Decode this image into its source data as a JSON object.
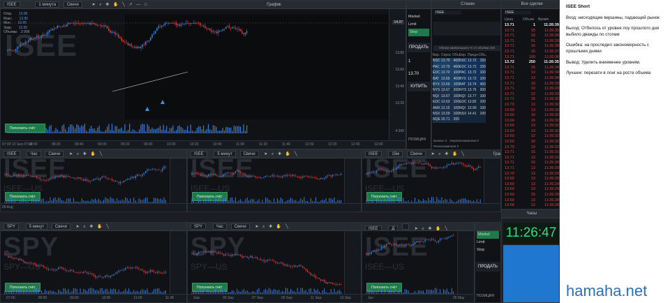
{
  "main_chart": {
    "symbol": "ISEE",
    "interval": "1 минута",
    "type": "Свечи",
    "title": "График",
    "ohlc_labels": [
      "Откр.",
      "Макс.",
      "Мин.",
      "Закр.",
      "Объемы"
    ],
    "ohlc_values": [
      "13.95",
      "13.95",
      "13.95",
      "13.95",
      "3 906"
    ],
    "price_ticks": [
      "14.37",
      "13.80",
      "13.60",
      "13.40",
      "13.20"
    ],
    "time_ticks": [
      "08:00",
      "08:20",
      "08:40",
      "09:00",
      "09:20",
      "09:40",
      "10:00",
      "10:20",
      "10:40",
      "11:00",
      "11:20",
      "11:40",
      "12:00",
      "12:20",
      "12:40",
      "13:00"
    ],
    "date_label": "07:00 13 Sep 07:22",
    "fill_button": "Пополнить счёт",
    "watermark": "ISEE",
    "volume_label": "4 200"
  },
  "order_panel": {
    "title": "Заявка",
    "type_items": [
      "Market",
      "Limit",
      "Stop"
    ],
    "sell_label": "ПРОДАТЬ",
    "qty": "1",
    "price": "13.70",
    "buy_label": "КУПИТЬ",
    "position_label": "ПОЗИЦИЯ"
  },
  "dom": {
    "title": "Стакан",
    "symbol": "ISEE",
    "header": [
      "Бир.",
      "Спрос",
      "Объ.",
      "Бир.",
      "Предл.",
      "Объ."
    ],
    "rows": [
      [
        "NSC",
        "13.70",
        "400",
        "NSC",
        "13.72",
        "150"
      ],
      [
        "PAC",
        "13.70",
        "400",
        "EDC",
        "13.72",
        "150"
      ],
      [
        "EDC",
        "13.70",
        "100",
        "PAC",
        "13.72",
        "100"
      ],
      [
        "BAT",
        "13.69",
        "400",
        "BYX",
        "13.73",
        "100"
      ],
      [
        "BYX",
        "13.69",
        "100",
        "BAT",
        "13.74",
        "400"
      ],
      [
        "NYS",
        "13.67",
        "200",
        "NYS",
        "13.76",
        "300"
      ],
      [
        "NQI",
        "13.67",
        "100",
        "NQI",
        "13.77",
        "100"
      ],
      [
        "EDC",
        "13.63",
        "100",
        "EDC",
        "13.82",
        "100"
      ],
      [
        "AMX",
        "13.15",
        "100",
        "NQI",
        "13.90",
        "100"
      ],
      [
        "NSX",
        "13.09",
        "100",
        "NSX",
        "14.41",
        "100"
      ],
      [
        "NQE",
        "15.71",
        "200",
        "",
        "",
        ""
      ]
    ],
    "bottom": [
      "Баланс 0",
      "Нереализованная 0",
      "Реализованная 0"
    ]
  },
  "trades": {
    "title": "Все сделки",
    "symbol": "ISEE",
    "header": [
      "Цена",
      "Объем",
      "Время"
    ],
    "rows": [
      [
        "13.71",
        "1",
        "11:26:39",
        "w"
      ],
      [
        "13.71",
        "15",
        "11:26:39",
        "r"
      ],
      [
        "13.71",
        "10",
        "11:26:39",
        "r"
      ],
      [
        "13.71",
        "51",
        "11:26:39",
        "r"
      ],
      [
        "13.71",
        "16",
        "11:26:38",
        "r"
      ],
      [
        "13.71",
        "15",
        "11:26:37",
        "r"
      ],
      [
        "13.71",
        "100",
        "11:26:36",
        "r"
      ],
      [
        "13.72",
        "250",
        "11:26:35",
        "w"
      ],
      [
        "13.71",
        "15",
        "11:26:34",
        "r"
      ],
      [
        "13.71",
        "13",
        "11:26:34",
        "r"
      ],
      [
        "13.71",
        "13",
        "11:26:34",
        "r"
      ],
      [
        "13.71",
        "10",
        "11:26:33",
        "r"
      ],
      [
        "13.71",
        "10",
        "11:26:33",
        "r"
      ],
      [
        "13.71",
        "12",
        "11:26:33",
        "r"
      ],
      [
        "13.71",
        "15",
        "11:26:32",
        "r"
      ],
      [
        "13.70",
        "13",
        "11:26:32",
        "r"
      ],
      [
        "13.69",
        "13",
        "11:26:32",
        "r"
      ],
      [
        "13.69",
        "10",
        "11:26:32",
        "r"
      ],
      [
        "13.69",
        "16",
        "11:26:32",
        "r"
      ],
      [
        "13.69",
        "13",
        "11:26:32",
        "r"
      ],
      [
        "13.69",
        "13",
        "11:26:32",
        "r"
      ],
      [
        "13.69",
        "12",
        "11:26:32",
        "r"
      ],
      [
        "13.69",
        "10",
        "11:26:32",
        "r"
      ],
      [
        "13.70",
        "13",
        "11:26:32",
        "r"
      ],
      [
        "13.71",
        "15",
        "11:26:31",
        "r"
      ],
      [
        "13.71",
        "13",
        "11:26:31",
        "r"
      ],
      [
        "13.71",
        "16",
        "11:26:30",
        "r"
      ],
      [
        "13.71",
        "13",
        "11:26:29",
        "r"
      ],
      [
        "13.70",
        "13",
        "11:26:29",
        "r"
      ],
      [
        "13.69",
        "13",
        "11:26:29",
        "r"
      ],
      [
        "13.69",
        "13",
        "11:26:29",
        "r"
      ],
      [
        "13.69",
        "13",
        "11:26:29",
        "r"
      ],
      [
        "13.69",
        "15",
        "11:26:29",
        "r"
      ],
      [
        "13.69",
        "13",
        "11:26:28",
        "r"
      ],
      [
        "13.68",
        "12",
        "11:26:28",
        "r"
      ]
    ]
  },
  "mid_charts": [
    {
      "symbol": "ISEE",
      "interval": "Час",
      "type": "Свечи",
      "title": "",
      "watermark": "ISEE",
      "sub": "ISEE—US",
      "fill": "Пополнить счёт",
      "date": "09 Aug"
    },
    {
      "symbol": "ISEE",
      "interval": "5 минут",
      "type": "Свечи",
      "title": "",
      "watermark": "ISEE",
      "sub": "ISEE—US",
      "fill": "Пополнить счёт",
      "date": ""
    },
    {
      "symbol": "ISEE",
      "interval": "15м",
      "type": "Свечи",
      "title": "График",
      "watermark": "ISEE",
      "sub": "ISEE—US",
      "fill": "Пополнить счёт",
      "date": ""
    }
  ],
  "bottom_charts": [
    {
      "symbol": "SPY",
      "interval": "5 минут",
      "type": "Свечи",
      "title": "",
      "watermark": "SPY",
      "sub": "SPY—US",
      "fill": "Пополнить счёт",
      "ticks": [
        "07:00",
        "08:00",
        "09:00",
        "10:00",
        "11:00",
        "11:45"
      ]
    },
    {
      "symbol": "SPY",
      "interval": "Час",
      "type": "Свечи",
      "title": "",
      "watermark": "SPY",
      "sub": "SPY—US",
      "fill": "Пополнить счёт",
      "ticks": [
        "Sep",
        "05 Sep",
        "07 Sep",
        "09 Sep",
        "11 Sep",
        "13 Sep"
      ]
    },
    {
      "symbol": "ISEE",
      "interval": "Д",
      "type": "",
      "title": "График",
      "watermark": "ISEE",
      "sub": "ISEE—US",
      "fill": "Пополнить счёт",
      "ticks": [
        "Jun",
        "26 May"
      ]
    }
  ],
  "order_panel2": {
    "type_items": [
      "Market",
      "Limit",
      "Stop"
    ],
    "sell_label": "ПРОДАТЬ",
    "position_label": "ПОЗИЦИЯ"
  },
  "clock": {
    "title": "Часы",
    "time": "11:26:47"
  },
  "notes": {
    "title": "ISEE Short",
    "paras": [
      "Вход: нисходящие вершины, падающий рынок",
      "Выход: Отбилось от уровня лоу прошлого дня выбило дважды по стопам",
      "Ошибка: на проследил закономерность с прошлыми днями",
      "Вывод: Уделить вниеменее уровням.",
      "Лучшее: перезати в лонг на росте объема"
    ]
  },
  "brand": "hamaha.net",
  "colors": {
    "up": "#3a7fd6",
    "down": "#d63a3a",
    "fill": "#1e7a4a",
    "clock": "#2fdc84"
  }
}
